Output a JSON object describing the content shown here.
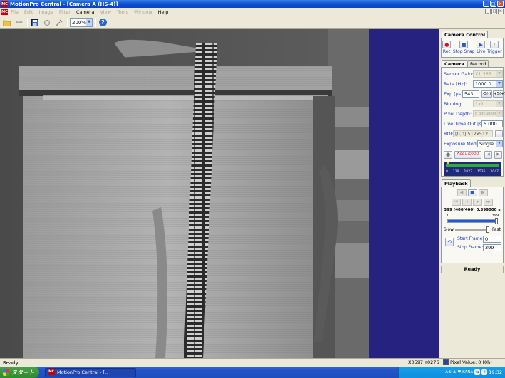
{
  "window": {
    "title": "MotionPro Central - [Camera A (HS-4)]",
    "app_icon": "MC"
  },
  "menu": {
    "items": [
      "File",
      "Edit",
      "Image",
      "Filter",
      "Camera",
      "View",
      "Tools",
      "Window",
      "Help"
    ]
  },
  "toolbar": {
    "zoom": "200%",
    "icons": [
      "open-folder-icon",
      "save-avi-icon",
      "save-icon",
      "refresh-icon",
      "settings-icon",
      "help-icon"
    ],
    "save_label": "AVI"
  },
  "panel": {
    "camera_control_tab": "Camera Control",
    "control_buttons": [
      {
        "label": "Rec",
        "icon": "record-icon",
        "color": "#e01010"
      },
      {
        "label": "Stop Snap",
        "icon": "stop-icon",
        "color": "#2a56c8"
      },
      {
        "label": "Live",
        "icon": "live-icon",
        "color": "#2a56c8"
      },
      {
        "label": "Trigger",
        "icon": "trigger-icon",
        "color": "#e0a010"
      }
    ],
    "tabs": {
      "camera": "Camera",
      "record": "Record"
    },
    "fields": {
      "sensor_gain": {
        "label": "Sensor Gain:",
        "value": "X1.333"
      },
      "rate": {
        "label": "Rate [Hz]:",
        "value": "1000.0"
      },
      "exposure": {
        "label": "Exp [µs]:",
        "value": "543",
        "btn_minus": "-5(-)",
        "btn_plus": "+5(+)"
      },
      "binning": {
        "label": "Binning:",
        "value": "1x1"
      },
      "pixel_depth": {
        "label": "Pixel Depth:",
        "value": "8 Bit (upper)"
      },
      "live_timeout": {
        "label": "Live Time Out [s]:",
        "value": "5.000"
      },
      "roi": {
        "label": "ROI:",
        "value": "[0,0] 512x512"
      },
      "exposure_mode": {
        "label": "Exposure Mode:",
        "value": "Single"
      }
    },
    "acquire_name": "Acquis000",
    "memory_ticks": [
      "0",
      "129",
      "1023",
      "1535",
      "2047"
    ],
    "playback_tab": "Playback",
    "frame_info": "399 (400/400)",
    "frame_time": "0.399000 s",
    "slider_min": "0",
    "slider_max": "399",
    "speed": {
      "slow": "Slow",
      "fast": "Fast"
    },
    "start_frame": {
      "label": "Start Frame:",
      "value": "0"
    },
    "stop_frame": {
      "label": "Stop Frame:",
      "value": "399"
    },
    "status": "Ready"
  },
  "statusbar": {
    "text": "Ready",
    "coords": "X0597  Y0276",
    "pixel_value": "Pixel Value: 0 (0h)"
  },
  "taskbar": {
    "start": "スタート",
    "task": "MotionPro Central - [..",
    "ime": "A① ⚓ ♥ KANA",
    "clock": "19:32"
  },
  "colors": {
    "accent": "#1a3ac4",
    "viewer_bg": "#262380",
    "titlebar": "#0a4fd0"
  }
}
